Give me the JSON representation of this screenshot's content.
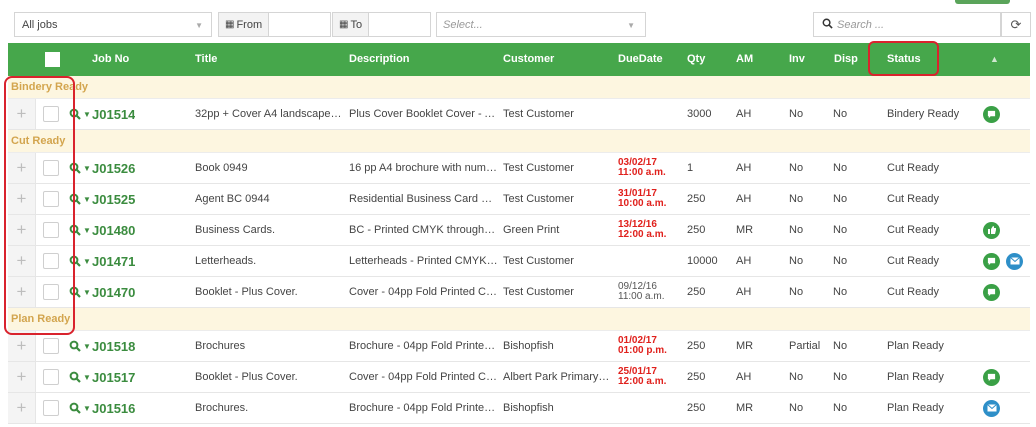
{
  "filters": {
    "jobs_select": "All jobs",
    "from_label": "From",
    "to_label": "To",
    "select_placeholder": "Select...",
    "search_placeholder": "Search ..."
  },
  "header": {
    "job_no": "Job No",
    "title": "Title",
    "description": "Description",
    "customer": "Customer",
    "due_date": "DueDate",
    "qty": "Qty",
    "am": "AM",
    "inv": "Inv",
    "disp": "Disp",
    "status": "Status"
  },
  "groups": [
    {
      "label": "Bindery Ready",
      "rows": [
        {
          "job": "J01514",
          "title": "32pp + Cover A4 landscape bo...",
          "description": "Plus Cover Booklet Cover - A4 (...",
          "customer": "Test Customer",
          "due_line1": "",
          "due_line2": "",
          "due_color": "grey",
          "qty": "3000",
          "am": "AH",
          "inv": "No",
          "disp": "No",
          "status": "Bindery Ready",
          "icons": [
            "chat-icon"
          ]
        }
      ]
    },
    {
      "label": "Cut Ready",
      "rows": [
        {
          "job": "J01526",
          "title": "Book 0949",
          "description": "16 pp A4 brochure with numero...",
          "customer": "Test Customer",
          "due_line1": "03/02/17",
          "due_line2": "11:00 a.m.",
          "due_color": "red",
          "qty": "1",
          "am": "AH",
          "inv": "No",
          "disp": "No",
          "status": "Cut Ready",
          "icons": []
        },
        {
          "job": "J01525",
          "title": "Agent BC 0944",
          "description": "Residential Business Card with...",
          "customer": "Test Customer",
          "due_line1": "31/01/17",
          "due_line2": "10:00 a.m.",
          "due_color": "red",
          "qty": "250",
          "am": "AH",
          "inv": "No",
          "disp": "No",
          "status": "Cut Ready",
          "icons": []
        },
        {
          "job": "J01480",
          "title": "Business Cards.",
          "description": "BC -  Printed CMYK throughou...",
          "customer": "Green Print",
          "due_line1": "13/12/16",
          "due_line2": "12:00 a.m.",
          "due_color": "red",
          "qty": "250",
          "am": "MR",
          "inv": "No",
          "disp": "No",
          "status": "Cut Ready",
          "icons": [
            "thumbs-up-icon"
          ]
        },
        {
          "job": "J01471",
          "title": "Letterheads.",
          "description": "Letterheads -  Printed CMYK x ...",
          "customer": "Test Customer",
          "due_line1": "",
          "due_line2": "",
          "due_color": "grey",
          "qty": "10000",
          "am": "AH",
          "inv": "No",
          "disp": "No",
          "status": "Cut Ready",
          "icons": [
            "chat-icon",
            "mail-icon"
          ]
        },
        {
          "job": "J01470",
          "title": "Booklet - Plus Cover.",
          "description": "Cover -  04pp Fold Printed CMY...",
          "customer": "Test Customer",
          "due_line1": "09/12/16",
          "due_line2": "11:00 a.m.",
          "due_color": "grey",
          "qty": "250",
          "am": "AH",
          "inv": "No",
          "disp": "No",
          "status": "Cut Ready",
          "icons": [
            "chat-icon"
          ]
        }
      ]
    },
    {
      "label": "Plan Ready",
      "rows": [
        {
          "job": "J01518",
          "title": "Brochures",
          "description": "Brochure -  04pp Fold Printed C...",
          "customer": "Bishopfish",
          "due_line1": "01/02/17",
          "due_line2": "01:00 p.m.",
          "due_color": "red",
          "qty": "250",
          "am": "MR",
          "inv": "Partial",
          "disp": "No",
          "status": "Plan Ready",
          "icons": []
        },
        {
          "job": "J01517",
          "title": "Booklet - Plus Cover.",
          "description": "Cover -  04pp Fold Printed CMY...",
          "customer": "Albert Park Primary Sc...",
          "due_line1": "25/01/17",
          "due_line2": "12:00 a.m.",
          "due_color": "red",
          "qty": "250",
          "am": "AH",
          "inv": "No",
          "disp": "No",
          "status": "Plan Ready",
          "icons": [
            "chat-icon"
          ]
        },
        {
          "job": "J01516",
          "title": "Brochures.",
          "description": "Brochure -  04pp Fold Printed C...",
          "customer": "Bishopfish",
          "due_line1": "",
          "due_line2": "",
          "due_color": "grey",
          "qty": "250",
          "am": "MR",
          "inv": "No",
          "disp": "No",
          "status": "Plan Ready",
          "icons": [
            "mail-icon"
          ]
        }
      ]
    }
  ]
}
